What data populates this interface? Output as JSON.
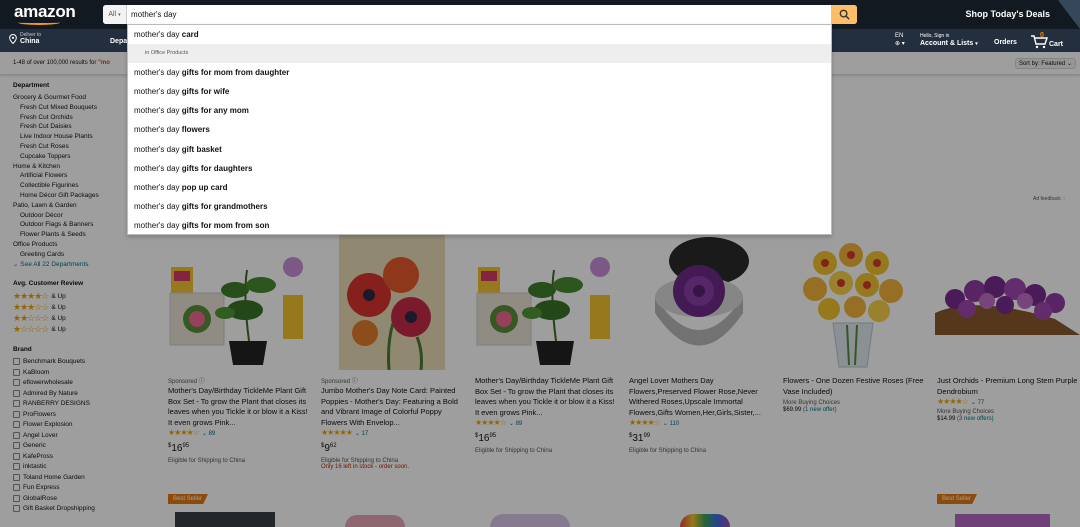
{
  "header": {
    "logo": "amazon",
    "search": {
      "category": "All",
      "query": "mother's day"
    },
    "deals": "Shop Today's Deals",
    "deliver_line1": "Deliver to",
    "deliver_line2": "China",
    "departments_label": "Depa",
    "lang": "EN",
    "account_line1": "Hello, Sign in",
    "account_line2": "Account & Lists",
    "orders": "Orders",
    "cart_count": "0",
    "cart_label": "Cart"
  },
  "subbar": {
    "results_prefix": "1-48 of over 100,000 results for ",
    "results_keyword": "\"mo",
    "sort": "Sort by: Featured"
  },
  "autocomplete": {
    "prefix": "mother's day",
    "items": [
      {
        "bold": "card"
      },
      {
        "hint_prefix": "in",
        "hint": "Office Products"
      },
      {
        "bold": "gifts for mom from daughter"
      },
      {
        "bold": "gifts for wife"
      },
      {
        "bold": "gifts for any mom"
      },
      {
        "bold": "flowers"
      },
      {
        "bold": "gift basket"
      },
      {
        "bold": "gifts for daughters"
      },
      {
        "bold": "pop up card"
      },
      {
        "bold": "gifts for grandmothers"
      },
      {
        "bold": "gifts for mom from son"
      }
    ]
  },
  "sidebar": {
    "department_heading": "Department",
    "departments": [
      {
        "label": "Grocery & Gourmet Food",
        "sub": false
      },
      {
        "label": "Fresh Cut Mixed Bouquets",
        "sub": true
      },
      {
        "label": "Fresh Cut Orchids",
        "sub": true
      },
      {
        "label": "Fresh Cut Daisies",
        "sub": true
      },
      {
        "label": "Live Indoor House Plants",
        "sub": true
      },
      {
        "label": "Fresh Cut Roses",
        "sub": true
      },
      {
        "label": "Cupcake Toppers",
        "sub": true
      },
      {
        "label": "Home & Kitchen",
        "sub": false
      },
      {
        "label": "Artificial Flowers",
        "sub": true
      },
      {
        "label": "Collectible Figurines",
        "sub": true
      },
      {
        "label": "Home Décor Gift Packages",
        "sub": true
      },
      {
        "label": "Patio, Lawn & Garden",
        "sub": false
      },
      {
        "label": "Outdoor Décor",
        "sub": true
      },
      {
        "label": "Outdoor Flags & Banners",
        "sub": true
      },
      {
        "label": "Flower Plants & Seeds",
        "sub": true
      },
      {
        "label": "Office Products",
        "sub": false
      },
      {
        "label": "Greeting Cards",
        "sub": true
      }
    ],
    "see_all": "See All 22 Departments",
    "review_heading": "Avg. Customer Review",
    "reviews": [
      {
        "stars": 4,
        "label": "& Up"
      },
      {
        "stars": 3,
        "label": "& Up"
      },
      {
        "stars": 2,
        "label": "& Up"
      },
      {
        "stars": 1,
        "label": "& Up"
      }
    ],
    "brand_heading": "Brand",
    "brands": [
      "Benchmark Bouquets",
      "KaBloom",
      "eflowerwholesale",
      "Admired By Nature",
      "RANBERRY DESIGNS",
      "ProFlowers",
      "Flower Explosion",
      "Angel Lover",
      "Generic",
      "KafePross",
      "inktastic",
      "Toland Home Garden",
      "Fun Express",
      "GlobalRose",
      "Gift Basket Dropshipping"
    ]
  },
  "ad_feedback": "Ad feedback",
  "products": [
    {
      "sponsored": "Sponsored",
      "title": "Mother's Day/Birthday TickleMe Plant Gift Box Set - To grow the Plant that closes its leaves when you Tickle it or blow it a Kiss! It even grows Pink...",
      "stars": "★★★★☆",
      "count": "89",
      "price_whole": "16",
      "price_frac": "95",
      "ship": "Eligible for Shipping to China"
    },
    {
      "sponsored": "Sponsored",
      "title": "Jumbo Mother's Day Note Card: Painted Poppies - Mother's Day: Featuring a Bold and Vibrant Image of Colorful Poppy Flowers With Envelop...",
      "stars": "★★★★★",
      "count": "17",
      "price_whole": "9",
      "price_frac": "62",
      "ship": "Eligible for Shipping to China",
      "stock": "Only 16 left in stock - order soon."
    },
    {
      "title": "Mother's Day/Birthday TickleMe Plant Gift Box Set - To grow the Plant that closes its leaves when you Tickle it or blow it a Kiss! It even grows Pink...",
      "stars": "★★★★☆",
      "count": "89",
      "price_whole": "16",
      "price_frac": "95",
      "ship": "Eligible for Shipping to China"
    },
    {
      "title": "Angel Lover Mothers Day Flowers,Preserved Flower Rose,Never Withered Roses,Upscale Immortal Flowers,Gifts Women,Her,Girls,Sister,...",
      "stars": "★★★★☆",
      "count": "110",
      "price_whole": "31",
      "price_frac": "99",
      "ship": "Eligible for Shipping to China"
    },
    {
      "title": "Flowers - One Dozen Festive Roses (Free Vase Included)",
      "mbo": "More Buying Choices",
      "mbo_price": "$69.99",
      "mbo_offer": "(1 new offer)"
    },
    {
      "title": "Just Orchids - Premium Long Stem Purple Dendrobium",
      "stars": "★★★★☆",
      "count": "77",
      "mbo": "More Buying Choices",
      "mbo_price": "$14.99",
      "mbo_offer": "(3 new offers)"
    }
  ],
  "badges": {
    "best_seller": "Best Seller"
  },
  "colors": {
    "header_bg": "#131921",
    "nav_bg": "#232f3e",
    "search_button": "#febd69",
    "link": "#007185",
    "star": "#f0a200",
    "best_seller": "#e47911"
  }
}
